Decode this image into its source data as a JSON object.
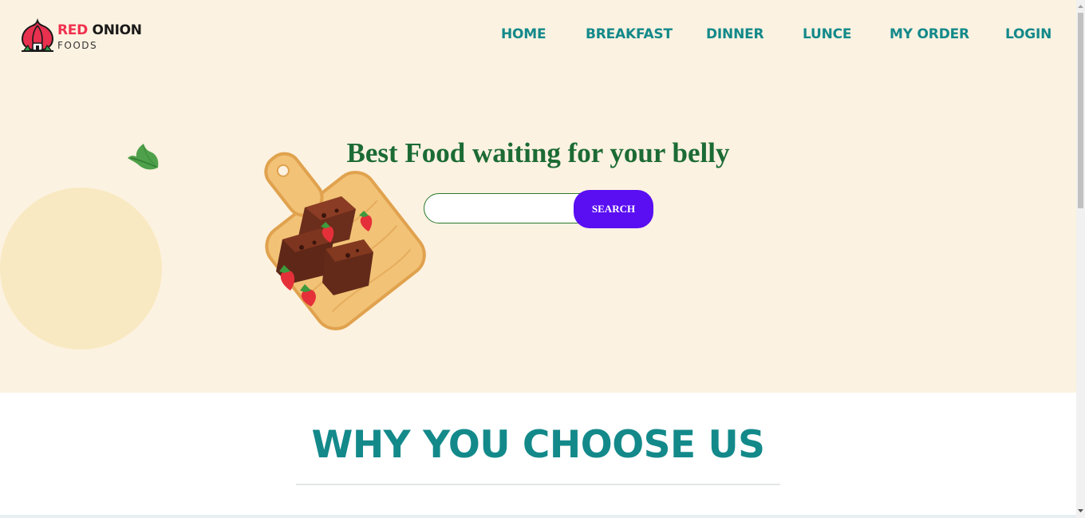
{
  "brand": {
    "name_red": "RED",
    "name_dark": "ONION",
    "subtitle": "FOODS",
    "accent_color": "#f0314f"
  },
  "nav": {
    "items": [
      {
        "label": "HOME"
      },
      {
        "label": "BREAKFAST"
      },
      {
        "label": "DINNER"
      },
      {
        "label": "LUNCE"
      },
      {
        "label": "MY ORDER"
      },
      {
        "label": "LOGIN"
      }
    ],
    "color": "#13898a"
  },
  "hero": {
    "headline": "Best Food waiting for your belly",
    "background": "#fcf2e1",
    "search": {
      "value": "",
      "placeholder": "",
      "button_label": "SEARCH",
      "button_color": "#5a0ef2"
    },
    "illustration": "brownies-on-cutting-board-with-strawberries"
  },
  "section": {
    "title": "WHY YOU CHOOSE US"
  }
}
